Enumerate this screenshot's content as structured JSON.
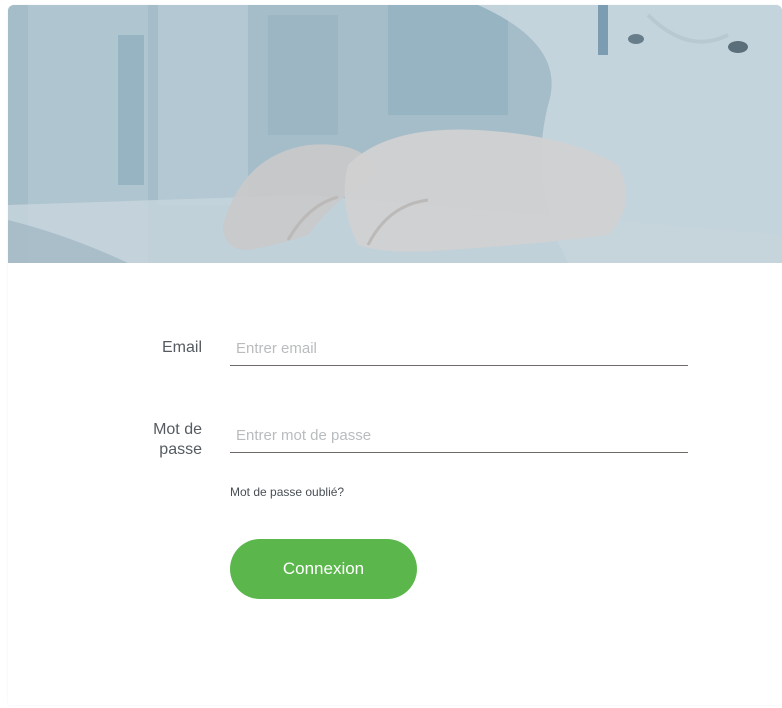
{
  "form": {
    "email_label": "Email",
    "email_placeholder": "Entrer email",
    "email_value": "",
    "password_label_line1": "Mot de",
    "password_label_line2": "passe",
    "password_placeholder": "Entrer mot de passe",
    "password_value": "",
    "forgot_link": "Mot de passe oublié?",
    "submit_label": "Connexion"
  },
  "colors": {
    "accent": "#5bb74c",
    "hero_tint": "#a9c0cc",
    "label": "#555b60",
    "placeholder": "#b9bcbf",
    "underline": "#6f6a67"
  },
  "hero": {
    "image": "medical-typing-photo"
  }
}
